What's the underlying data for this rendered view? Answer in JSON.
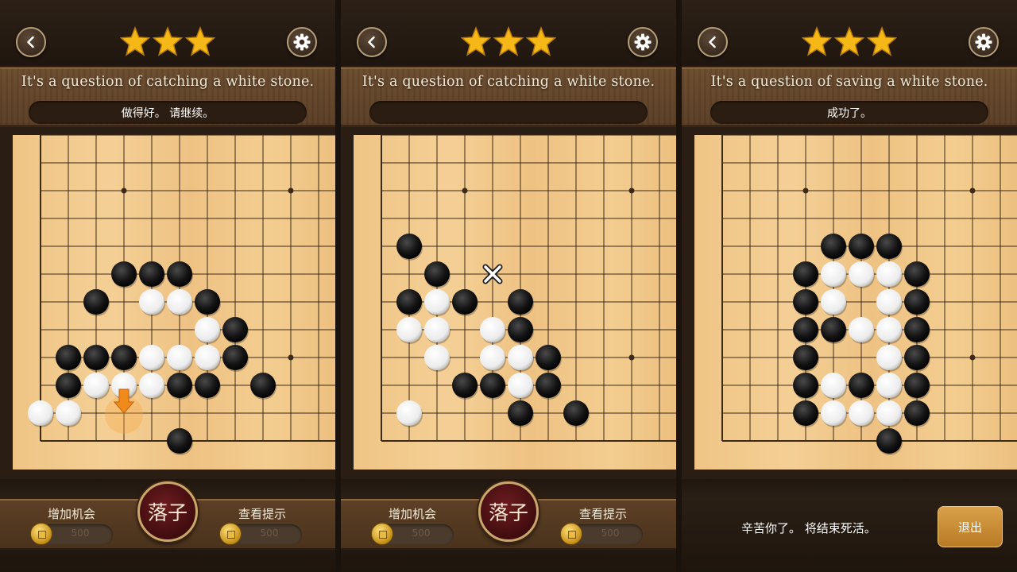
{
  "colors": {
    "board": "#f0c98a",
    "line": "#3b2a1a",
    "black_stone": "#111111",
    "white_stone": "#f4f4f4",
    "hint_arrow": "#f08a1a",
    "star": "#f5b817"
  },
  "icons": [
    "back-icon",
    "gear-icon",
    "star-icon",
    "coin-icon",
    "arrow-down-icon",
    "cross-icon"
  ],
  "panels": [
    {
      "stars": 3,
      "question": "It's a question of catching a white stone.",
      "status": "做得好。 请继续。",
      "bottom": {
        "add_chance": "增加机会",
        "add_chance_cost": "500",
        "place_stone": "落子",
        "view_hint": "查看提示",
        "view_hint_cost": "500"
      },
      "board": {
        "black": [
          [
            3,
            5
          ],
          [
            4,
            5
          ],
          [
            5,
            5
          ],
          [
            2,
            6
          ],
          [
            6,
            6
          ],
          [
            7,
            7
          ],
          [
            1,
            8
          ],
          [
            2,
            8
          ],
          [
            3,
            8
          ],
          [
            7,
            8
          ],
          [
            1,
            9
          ],
          [
            5,
            9
          ],
          [
            6,
            9
          ],
          [
            8,
            9
          ],
          [
            5,
            11
          ]
        ],
        "white": [
          [
            4,
            6
          ],
          [
            5,
            6
          ],
          [
            6,
            7
          ],
          [
            4,
            8
          ],
          [
            5,
            8
          ],
          [
            6,
            8
          ],
          [
            2,
            9
          ],
          [
            3,
            9
          ],
          [
            4,
            9
          ],
          [
            0,
            10
          ],
          [
            1,
            10
          ]
        ],
        "hint_arrow": [
          3,
          10
        ]
      }
    },
    {
      "stars": 3,
      "question": "It's a question of catching a white stone.",
      "status": "",
      "bottom": {
        "add_chance": "增加机会",
        "add_chance_cost": "500",
        "place_stone": "落子",
        "view_hint": "查看提示",
        "view_hint_cost": "500"
      },
      "board": {
        "black": [
          [
            1,
            4
          ],
          [
            2,
            5
          ],
          [
            1,
            6
          ],
          [
            3,
            6
          ],
          [
            5,
            6
          ],
          [
            5,
            7
          ],
          [
            6,
            8
          ],
          [
            3,
            9
          ],
          [
            4,
            9
          ],
          [
            6,
            9
          ],
          [
            5,
            10
          ],
          [
            7,
            10
          ]
        ],
        "white": [
          [
            2,
            6
          ],
          [
            1,
            7
          ],
          [
            2,
            7
          ],
          [
            4,
            7
          ],
          [
            2,
            8
          ],
          [
            4,
            8
          ],
          [
            5,
            8
          ],
          [
            5,
            9
          ],
          [
            1,
            10
          ]
        ],
        "cross_mark": [
          4,
          5
        ]
      }
    },
    {
      "stars": 3,
      "question": "It's a question of saving a white stone.",
      "status": "成功了。",
      "bottom": {
        "end_message": "辛苦你了。 将结束死活。",
        "exit": "退出"
      },
      "board": {
        "black": [
          [
            4,
            4
          ],
          [
            5,
            4
          ],
          [
            6,
            4
          ],
          [
            3,
            5
          ],
          [
            7,
            5
          ],
          [
            3,
            6
          ],
          [
            7,
            6
          ],
          [
            3,
            7
          ],
          [
            4,
            7
          ],
          [
            7,
            7
          ],
          [
            3,
            8
          ],
          [
            7,
            8
          ],
          [
            3,
            9
          ],
          [
            5,
            9
          ],
          [
            7,
            9
          ],
          [
            3,
            10
          ],
          [
            7,
            10
          ],
          [
            6,
            11
          ]
        ],
        "white": [
          [
            4,
            5
          ],
          [
            5,
            5
          ],
          [
            6,
            5
          ],
          [
            4,
            6
          ],
          [
            6,
            6
          ],
          [
            5,
            7
          ],
          [
            6,
            7
          ],
          [
            6,
            8
          ],
          [
            4,
            9
          ],
          [
            6,
            9
          ],
          [
            4,
            10
          ],
          [
            5,
            10
          ],
          [
            6,
            10
          ]
        ]
      }
    }
  ]
}
